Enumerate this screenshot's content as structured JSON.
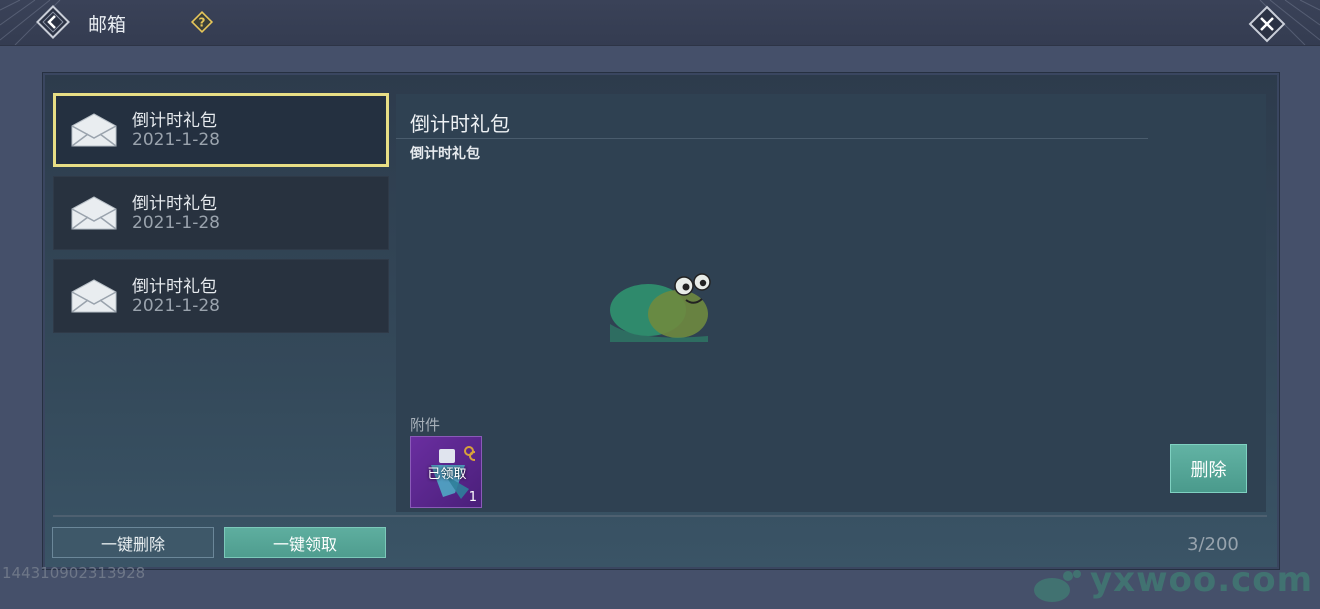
{
  "header": {
    "title": "邮箱"
  },
  "mail_list": [
    {
      "title": "倒计时礼包",
      "date": "2021-1-28",
      "selected": true
    },
    {
      "title": "倒计时礼包",
      "date": "2021-1-28",
      "selected": false
    },
    {
      "title": "倒计时礼包",
      "date": "2021-1-28",
      "selected": false
    }
  ],
  "detail": {
    "title": "倒计时礼包",
    "body": "倒计时礼包",
    "attachment_label": "附件",
    "attachment": {
      "status": "已领取",
      "quantity": "1"
    },
    "delete_label": "删除"
  },
  "footer": {
    "delete_all_label": "一键删除",
    "claim_all_label": "一键领取",
    "count": "3/200"
  },
  "uid": "144310902313928",
  "watermark": "yxwoo.com",
  "colors": {
    "selected_border": "#e8de85",
    "accent_button": "#5eae9f"
  }
}
